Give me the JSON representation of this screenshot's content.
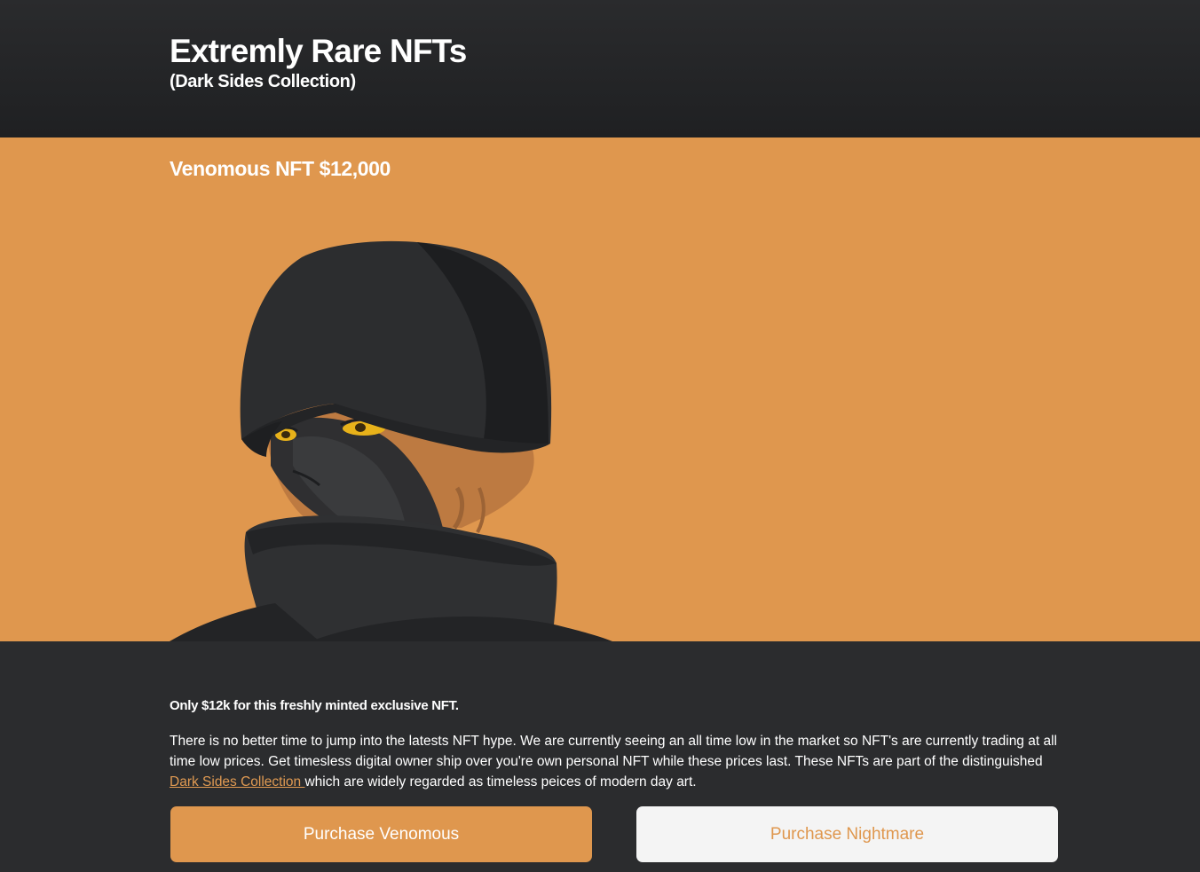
{
  "header": {
    "title": "Extremly Rare NFTs",
    "subtitle": "(Dark Sides Collection)"
  },
  "hero": {
    "title": "Venomous NFT $12,000",
    "background_color": "#df974e",
    "artwork": "hooded-figure-illustration"
  },
  "content": {
    "lead": "Only $12k for this freshly minted exclusive NFT.",
    "desc_before": "There is no better time to jump into the latests NFT hype. We are currently seeing an all time low in the market so NFT's are currently trading at all time low prices. Get timesless digital owner ship over you're own personal NFT while these prices last. These NFTs are part of the distinguished ",
    "desc_link": "Dark Sides Collection ",
    "desc_after": "which are widely regarded as timeless peices of modern day art."
  },
  "buttons": {
    "primary": "Purchase Venomous",
    "secondary": "Purchase Nightmare"
  },
  "colors": {
    "accent": "#df974e",
    "dark": "#2b2c2e",
    "light": "#f4f4f4"
  }
}
